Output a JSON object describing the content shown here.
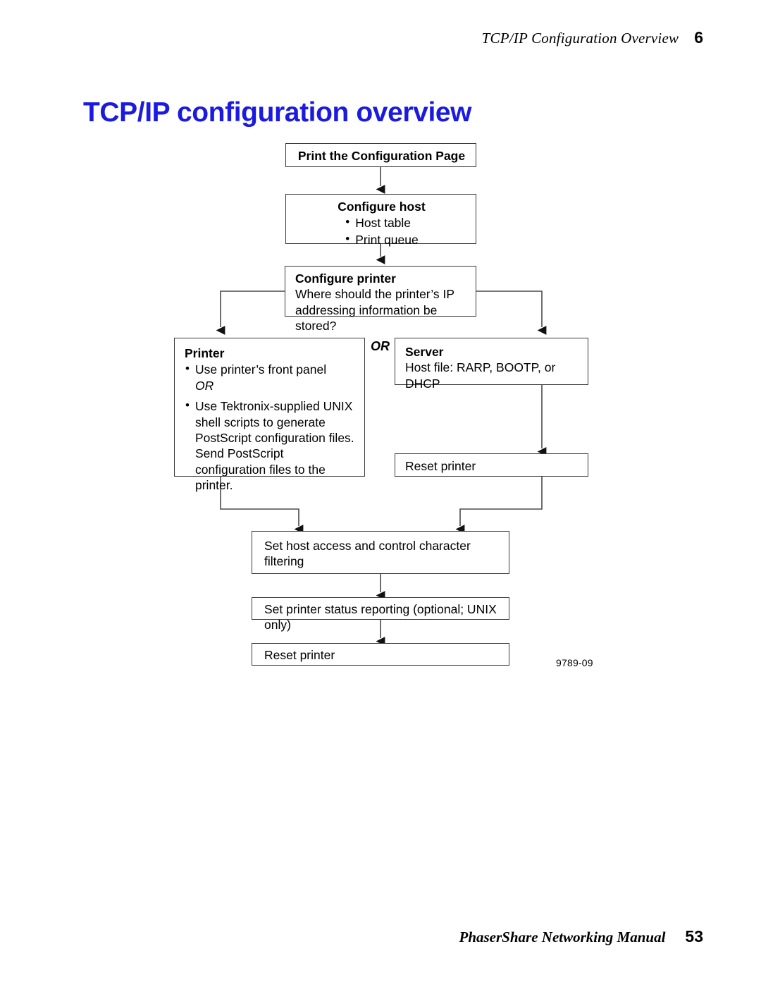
{
  "running_head": {
    "title": "TCP/IP Configuration Overview",
    "chapter": "6"
  },
  "page_title": "TCP/IP configuration overview",
  "footer": {
    "manual_title": "PhaserShare Networking Manual",
    "page_number": "53"
  },
  "figure": {
    "id_label": "9789-09",
    "or_label": "OR",
    "boxes": {
      "print_config_page": {
        "title": "Print the Configuration Page"
      },
      "configure_host": {
        "title": "Configure host",
        "bullets": [
          "Host table",
          "Print queue"
        ]
      },
      "configure_printer": {
        "title": "Configure printer",
        "body": "Where should the printer’s IP addressing information be stored?"
      },
      "printer": {
        "title": "Printer",
        "bullet1": "Use printer’s front panel",
        "or": "OR",
        "bullet2": "Use Tektronix-supplied UNIX shell scripts to generate PostScript configuration files. Send PostScript configuration files to the printer."
      },
      "server": {
        "title": "Server",
        "body": "Host file: RARP, BOOTP, or DHCP"
      },
      "reset_printer_server": {
        "title": "Reset printer"
      },
      "set_host_access": {
        "title": "Set host access and control character filtering"
      },
      "set_status_reporting": {
        "title": "Set printer status reporting (optional; UNIX only)"
      },
      "reset_printer_final": {
        "title": "Reset printer"
      }
    }
  },
  "colors": {
    "title_blue": "#1a1ae0",
    "box_border": "#3a3a3a",
    "connector": "#4a4a4a",
    "text": "#000000"
  }
}
